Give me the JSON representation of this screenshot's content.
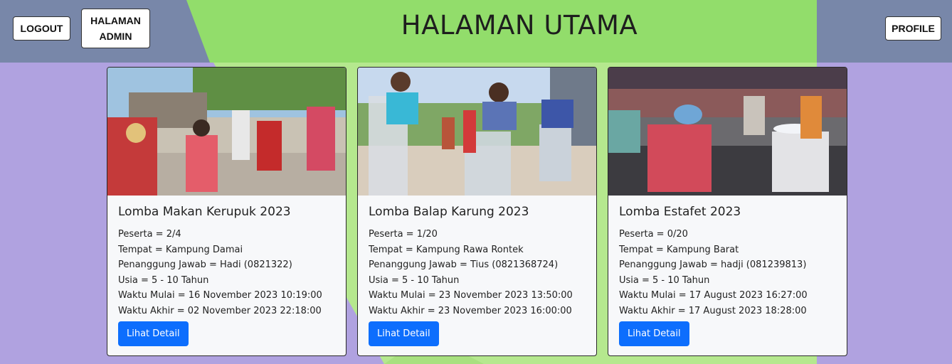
{
  "colors": {
    "page_bg": "#b0a2e0",
    "header_side": "#7887a9",
    "header_center": "#92dd6b",
    "center_band": "#b5e88e",
    "button_primary": "#0d6efd"
  },
  "header": {
    "title": "HALAMAN UTAMA",
    "logout_label": "LOGOUT",
    "admin_label": "HALAMAN ADMIN",
    "profile_label": "PROFILE"
  },
  "cards": [
    {
      "image_icon": "photo-kids-eating-crackers",
      "title": "Lomba Makan Kerupuk 2023",
      "peserta": "Peserta = 2/4",
      "tempat": "Tempat = Kampung Damai",
      "penanggung": "Penanggung Jawab = Hadi (0821322)",
      "usia": "Usia = 5 - 10 Tahun",
      "mulai": "Waktu Mulai = 16 November 2023 10:19:00",
      "akhir": "Waktu Akhir = 02 November 2023 22:18:00",
      "button": "Lihat Detail"
    },
    {
      "image_icon": "photo-sack-race",
      "title": "Lomba Balap Karung 2023",
      "peserta": "Peserta = 1/20",
      "tempat": "Tempat = Kampung Rawa Rontek",
      "penanggung": "Penanggung Jawab = Tius (0821368724)",
      "usia": "Usia = 5 - 10 Tahun",
      "mulai": "Waktu Mulai = 23 November 2023 13:50:00",
      "akhir": "Waktu Akhir = 23 November 2023 16:00:00",
      "button": "Lihat Detail"
    },
    {
      "image_icon": "photo-relay-race",
      "title": "Lomba Estafet 2023",
      "peserta": "Peserta = 0/20",
      "tempat": "Tempat = Kampung Barat",
      "penanggung": "Penanggung Jawab = hadji (081239813)",
      "usia": "Usia = 5 - 10 Tahun",
      "mulai": "Waktu Mulai = 17 August 2023 16:27:00",
      "akhir": "Waktu Akhir = 17 August 2023 18:28:00",
      "button": "Lihat Detail"
    }
  ]
}
